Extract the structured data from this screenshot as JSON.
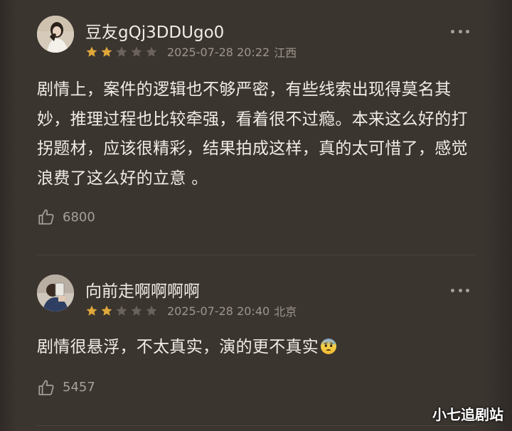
{
  "colors": {
    "background": "#3b3530",
    "star_filled": "#e0a83a",
    "star_empty": "#6a625b",
    "text_primary": "#f1ece6",
    "text_secondary": "#9d958d"
  },
  "comments": [
    {
      "username": "豆友gQj3DDUgo0",
      "rating": 2,
      "rating_max": 5,
      "datetime": "2025-07-28 20:22",
      "location": "江西",
      "content": "剧情上，案件的逻辑也不够严密，有些线索出现得莫名其妙，推理过程也比较牵强，看着很不过瘾。本来这么好的打拐题材，应该很精彩，结果拍成这样，真的太可惜了，感觉浪费了这么好的立意 。",
      "emoji": "",
      "likes": "6800"
    },
    {
      "username": "向前走啊啊啊啊",
      "rating": 2,
      "rating_max": 5,
      "datetime": "2025-07-28 20:40",
      "location": "北京",
      "content": "剧情很悬浮，不太真实，演的更不真实",
      "emoji": "anxious-face-with-sweat",
      "likes": "5457"
    }
  ],
  "icons": {
    "more": "more-dots-icon",
    "like": "thumbs-up-icon",
    "star": "star-icon"
  },
  "watermark": "小七追剧站"
}
